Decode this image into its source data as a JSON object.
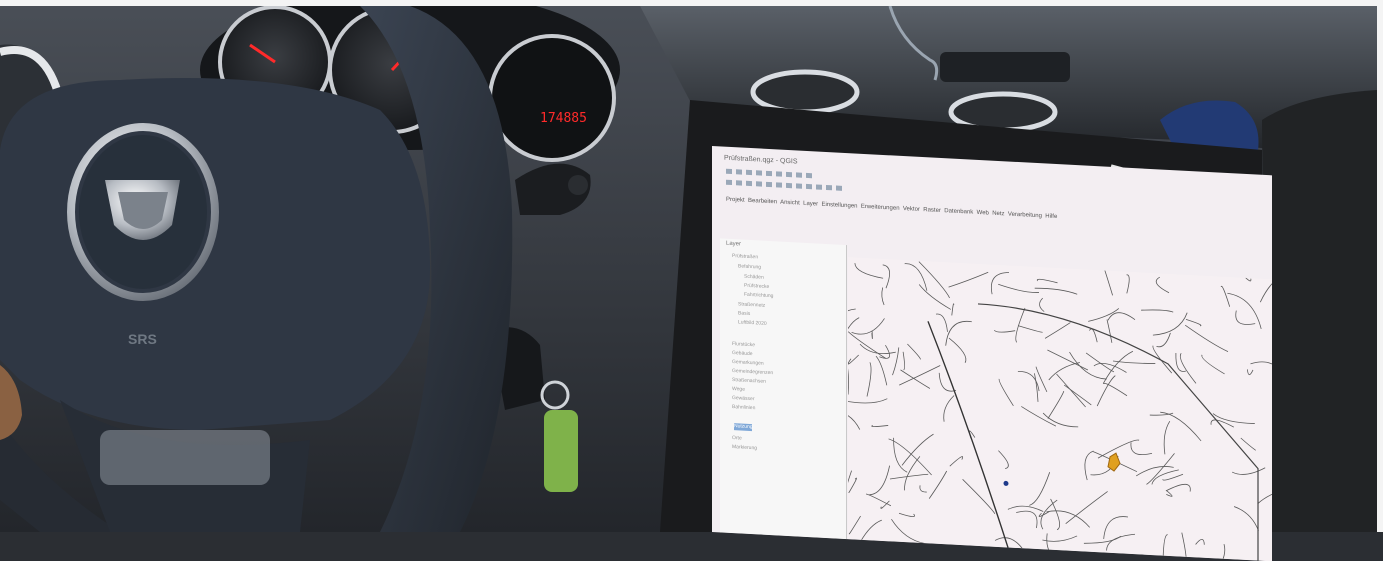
{
  "scene": {
    "description_kind": "photo",
    "odometer_reading": "174885",
    "horn_badge_text": "SRS"
  },
  "laptop": {
    "app_title": "Prüfstraßen.qgz - QGIS",
    "menu_items": [
      "Projekt",
      "Bearbeiten",
      "Ansicht",
      "Layer",
      "Einstellungen",
      "Erweiterungen",
      "Vektor",
      "Raster",
      "Datenbank",
      "Web",
      "Netz",
      "Verarbeitung",
      "Hilfe"
    ],
    "layers_panel_title": "Layer",
    "layers": [
      "Prüfstraßen",
      "Befahrung",
      "Schäden",
      "Prüfstrecke",
      "Fahrtrichtung",
      "Straßennetz",
      "Basis",
      "Luftbild 2020",
      "",
      "Flurstücke",
      "Gebäude",
      "Gemarkungen",
      "Gemeindegrenzen",
      "Straßenachsen",
      "Wege",
      "Gewässer",
      "Bahnlinien",
      "Nutzung",
      "Orte",
      "Markierung"
    ],
    "selected_layer_index": 17,
    "colors": {
      "map_background": "#f6f0f3",
      "road_line": "#5a5a5a",
      "highlight_parcel": "#e0a020",
      "panel_selection": "#7fa8d8"
    }
  }
}
